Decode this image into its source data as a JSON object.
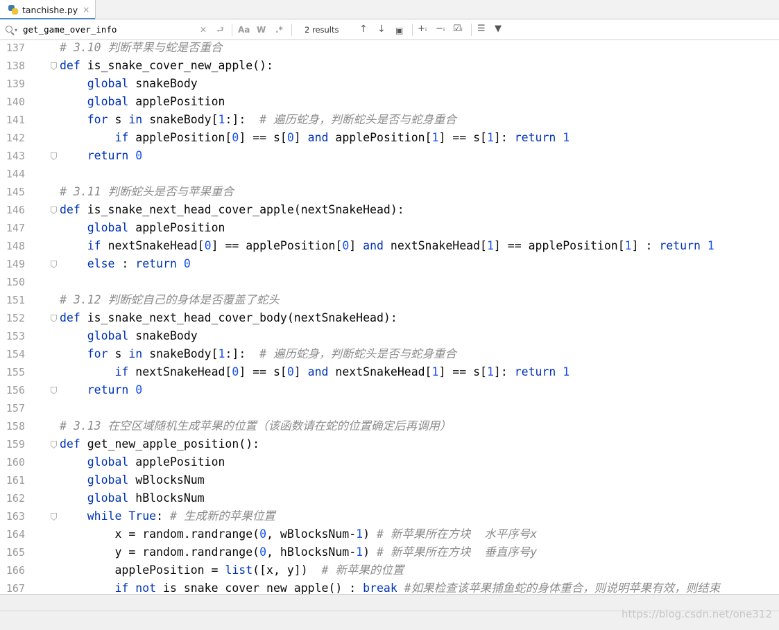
{
  "tab": {
    "filename": "tanchishe.py",
    "close_glyph": "×"
  },
  "find": {
    "query": "get_game_over_info",
    "results_text": "2 results",
    "match_case_label": "Aa",
    "words_label": "W",
    "regex_label": ".*"
  },
  "icons": [
    "python-file-icon",
    "search-icon",
    "clear-icon",
    "new-line-icon",
    "up-arrow-icon",
    "down-arrow-icon",
    "select-all-icon",
    "add-selection-icon",
    "remove-selection-icon",
    "select-all-occurrences-icon",
    "filter-options-icon",
    "filter-icon"
  ],
  "colors": {
    "keyword": "#0033b3",
    "number": "#1750eb",
    "comment": "#8c8c8c",
    "identifier": "#080808",
    "line_number": "#9a9a9a"
  },
  "code": [
    {
      "n": "137",
      "t": [
        [
          "cm",
          "# 3.10 判断苹果与蛇是否重合"
        ]
      ],
      "fold": false
    },
    {
      "n": "138",
      "t": [
        [
          "kw",
          "def "
        ],
        [
          "id",
          "is_snake_cover_new_apple():"
        ]
      ],
      "fold": true
    },
    {
      "n": "139",
      "t": [
        [
          "id",
          "    "
        ],
        [
          "kw",
          "global "
        ],
        [
          "id",
          "snakeBody"
        ]
      ],
      "fold": false
    },
    {
      "n": "140",
      "t": [
        [
          "id",
          "    "
        ],
        [
          "kw",
          "global "
        ],
        [
          "id",
          "applePosition"
        ]
      ],
      "fold": false
    },
    {
      "n": "141",
      "t": [
        [
          "id",
          "    "
        ],
        [
          "kw",
          "for "
        ],
        [
          "id",
          "s "
        ],
        [
          "kw",
          "in "
        ],
        [
          "id",
          "snakeBody["
        ],
        [
          "num",
          "1"
        ],
        [
          "id",
          ":]:  "
        ],
        [
          "cm",
          "# 遍历蛇身，判断蛇头是否与蛇身重合"
        ]
      ],
      "fold": false
    },
    {
      "n": "142",
      "t": [
        [
          "id",
          "        "
        ],
        [
          "kw",
          "if "
        ],
        [
          "id",
          "applePosition["
        ],
        [
          "num",
          "0"
        ],
        [
          "id",
          "] == s["
        ],
        [
          "num",
          "0"
        ],
        [
          "id",
          "] "
        ],
        [
          "kw",
          "and "
        ],
        [
          "id",
          "applePosition["
        ],
        [
          "num",
          "1"
        ],
        [
          "id",
          "] == s["
        ],
        [
          "num",
          "1"
        ],
        [
          "id",
          "]: "
        ],
        [
          "kw",
          "return "
        ],
        [
          "num",
          "1"
        ]
      ],
      "fold": false
    },
    {
      "n": "143",
      "t": [
        [
          "id",
          "    "
        ],
        [
          "kw",
          "return "
        ],
        [
          "num",
          "0"
        ]
      ],
      "fold": true
    },
    {
      "n": "144",
      "t": [],
      "fold": false
    },
    {
      "n": "145",
      "t": [
        [
          "cm",
          "# 3.11 判断蛇头是否与苹果重合"
        ]
      ],
      "fold": false
    },
    {
      "n": "146",
      "t": [
        [
          "kw",
          "def "
        ],
        [
          "id",
          "is_snake_next_head_cover_apple(nextSnakeHead):"
        ]
      ],
      "fold": true
    },
    {
      "n": "147",
      "t": [
        [
          "id",
          "    "
        ],
        [
          "kw",
          "global "
        ],
        [
          "id",
          "applePosition"
        ]
      ],
      "fold": false
    },
    {
      "n": "148",
      "t": [
        [
          "id",
          "    "
        ],
        [
          "kw",
          "if "
        ],
        [
          "id",
          "nextSnakeHead["
        ],
        [
          "num",
          "0"
        ],
        [
          "id",
          "] == applePosition["
        ],
        [
          "num",
          "0"
        ],
        [
          "id",
          "] "
        ],
        [
          "kw",
          "and "
        ],
        [
          "id",
          "nextSnakeHead["
        ],
        [
          "num",
          "1"
        ],
        [
          "id",
          "] == applePosition["
        ],
        [
          "num",
          "1"
        ],
        [
          "id",
          "] : "
        ],
        [
          "kw",
          "return "
        ],
        [
          "num",
          "1"
        ]
      ],
      "fold": false
    },
    {
      "n": "149",
      "t": [
        [
          "id",
          "    "
        ],
        [
          "kw",
          "else "
        ],
        [
          "id",
          ": "
        ],
        [
          "kw",
          "return "
        ],
        [
          "num",
          "0"
        ]
      ],
      "fold": true
    },
    {
      "n": "150",
      "t": [],
      "fold": false
    },
    {
      "n": "151",
      "t": [
        [
          "cm",
          "# 3.12 判断蛇自己的身体是否覆盖了蛇头"
        ]
      ],
      "fold": false
    },
    {
      "n": "152",
      "t": [
        [
          "kw",
          "def "
        ],
        [
          "id",
          "is_snake_next_head_cover_body(nextSnakeHead):"
        ]
      ],
      "fold": true
    },
    {
      "n": "153",
      "t": [
        [
          "id",
          "    "
        ],
        [
          "kw",
          "global "
        ],
        [
          "id",
          "snakeBody"
        ]
      ],
      "fold": false
    },
    {
      "n": "154",
      "t": [
        [
          "id",
          "    "
        ],
        [
          "kw",
          "for "
        ],
        [
          "id",
          "s "
        ],
        [
          "kw",
          "in "
        ],
        [
          "id",
          "snakeBody["
        ],
        [
          "num",
          "1"
        ],
        [
          "id",
          ":]:  "
        ],
        [
          "cm",
          "# 遍历蛇身，判断蛇头是否与蛇身重合"
        ]
      ],
      "fold": false
    },
    {
      "n": "155",
      "t": [
        [
          "id",
          "        "
        ],
        [
          "kw",
          "if "
        ],
        [
          "id",
          "nextSnakeHead["
        ],
        [
          "num",
          "0"
        ],
        [
          "id",
          "] == s["
        ],
        [
          "num",
          "0"
        ],
        [
          "id",
          "] "
        ],
        [
          "kw",
          "and "
        ],
        [
          "id",
          "nextSnakeHead["
        ],
        [
          "num",
          "1"
        ],
        [
          "id",
          "] == s["
        ],
        [
          "num",
          "1"
        ],
        [
          "id",
          "]: "
        ],
        [
          "kw",
          "return "
        ],
        [
          "num",
          "1"
        ]
      ],
      "fold": false
    },
    {
      "n": "156",
      "t": [
        [
          "id",
          "    "
        ],
        [
          "kw",
          "return "
        ],
        [
          "num",
          "0"
        ]
      ],
      "fold": true
    },
    {
      "n": "157",
      "t": [],
      "fold": false
    },
    {
      "n": "158",
      "t": [
        [
          "cm",
          "# 3.13 在空区域随机生成苹果的位置（该函数请在蛇的位置确定后再调用）"
        ]
      ],
      "fold": false
    },
    {
      "n": "159",
      "t": [
        [
          "kw",
          "def "
        ],
        [
          "id",
          "get_new_apple_position():"
        ]
      ],
      "fold": true
    },
    {
      "n": "160",
      "t": [
        [
          "id",
          "    "
        ],
        [
          "kw",
          "global "
        ],
        [
          "id",
          "applePosition"
        ]
      ],
      "fold": false
    },
    {
      "n": "161",
      "t": [
        [
          "id",
          "    "
        ],
        [
          "kw",
          "global "
        ],
        [
          "id",
          "wBlocksNum"
        ]
      ],
      "fold": false
    },
    {
      "n": "162",
      "t": [
        [
          "id",
          "    "
        ],
        [
          "kw",
          "global "
        ],
        [
          "id",
          "hBlocksNum"
        ]
      ],
      "fold": false
    },
    {
      "n": "163",
      "t": [
        [
          "id",
          "    "
        ],
        [
          "kw",
          "while True"
        ],
        [
          "id",
          ": "
        ],
        [
          "cm",
          "# 生成新的苹果位置"
        ]
      ],
      "fold": true
    },
    {
      "n": "164",
      "t": [
        [
          "id",
          "        x = random.randrange("
        ],
        [
          "num",
          "0"
        ],
        [
          "id",
          ", wBlocksNum-"
        ],
        [
          "num",
          "1"
        ],
        [
          "id",
          ") "
        ],
        [
          "cm",
          "# 新苹果所在方块  水平序号x"
        ]
      ],
      "fold": false
    },
    {
      "n": "165",
      "t": [
        [
          "id",
          "        y = random.randrange("
        ],
        [
          "num",
          "0"
        ],
        [
          "id",
          ", hBlocksNum-"
        ],
        [
          "num",
          "1"
        ],
        [
          "id",
          ") "
        ],
        [
          "cm",
          "# 新苹果所在方块  垂直序号y"
        ]
      ],
      "fold": false
    },
    {
      "n": "166",
      "t": [
        [
          "id",
          "        applePosition = "
        ],
        [
          "kw",
          "list"
        ],
        [
          "id",
          "([x, y])  "
        ],
        [
          "cm",
          "# 新苹果的位置"
        ]
      ],
      "fold": false
    },
    {
      "n": "167",
      "t": [
        [
          "id",
          "        "
        ],
        [
          "kw",
          "if not "
        ],
        [
          "id",
          "is_snake_cover_new_apple() : "
        ],
        [
          "kw",
          "break "
        ],
        [
          "cm",
          "#如果检查该苹果捕鱼蛇的身体重合，则说明苹果有效，则结束"
        ]
      ],
      "fold": false
    }
  ],
  "watermark": "https://blog.csdn.net/one312"
}
